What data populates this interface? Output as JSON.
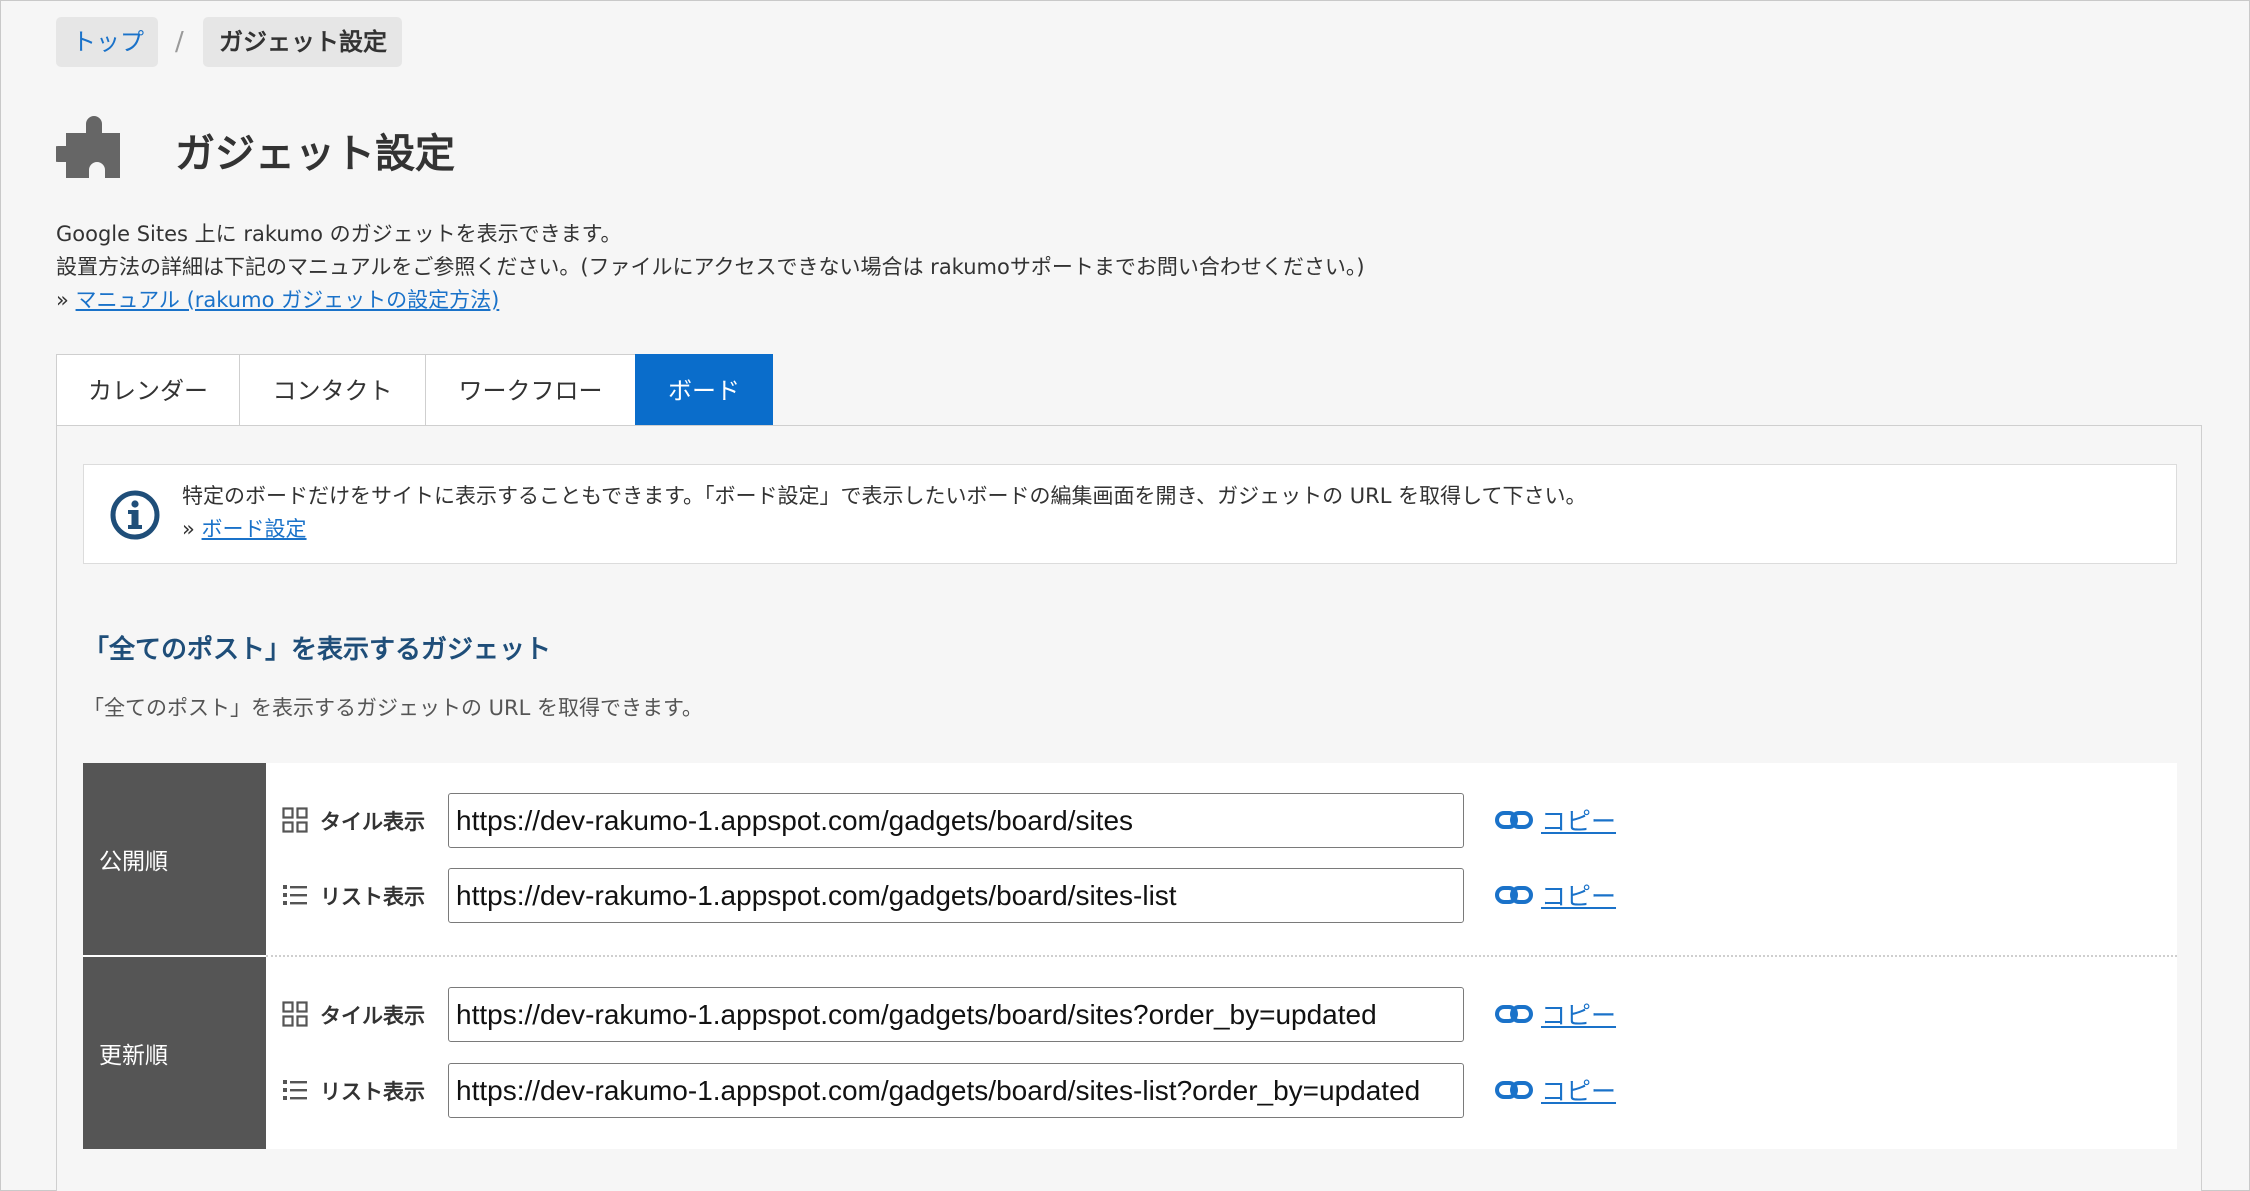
{
  "breadcrumb": {
    "top": "トップ",
    "separator": "/",
    "current": "ガジェット設定"
  },
  "page": {
    "title": "ガジェット設定"
  },
  "intro": {
    "line1": "Google Sites 上に rakumo のガジェットを表示できます。",
    "line2": "設置方法の詳細は下記のマニュアルをご参照ください。(ファイルにアクセスできない場合は rakumoサポートまでお問い合わせください。)",
    "prefix": "»",
    "manual_link": "マニュアル (rakumo ガジェットの設定方法)"
  },
  "tabs": [
    {
      "label": "カレンダー",
      "active": false
    },
    {
      "label": "コンタクト",
      "active": false
    },
    {
      "label": "ワークフロー",
      "active": false
    },
    {
      "label": "ボード",
      "active": true
    }
  ],
  "info": {
    "text": "特定のボードだけをサイトに表示することもできます。「ボード設定」で表示したいボードの編集画面を開き、ガジェットの URL を取得して下さい。",
    "prefix": "»",
    "link": "ボード設定"
  },
  "section": {
    "title": "「全てのポスト」を表示するガジェット",
    "description": "「全てのポスト」を表示するガジェットの URL を取得できます。"
  },
  "rows": [
    {
      "heading": "公開順",
      "lines": [
        {
          "mode": "タイル表示",
          "icon": "tile-icon",
          "url": "https://dev-rakumo-1.appspot.com/gadgets/board/sites",
          "copy": "コピー"
        },
        {
          "mode": "リスト表示",
          "icon": "list-icon",
          "url": "https://dev-rakumo-1.appspot.com/gadgets/board/sites-list",
          "copy": "コピー"
        }
      ]
    },
    {
      "heading": "更新順",
      "lines": [
        {
          "mode": "タイル表示",
          "icon": "tile-icon",
          "url": "https://dev-rakumo-1.appspot.com/gadgets/board/sites?order_by=updated",
          "copy": "コピー"
        },
        {
          "mode": "リスト表示",
          "icon": "list-icon",
          "url": "https://dev-rakumo-1.appspot.com/gadgets/board/sites-list?order_by=updated",
          "copy": "コピー"
        }
      ]
    }
  ],
  "colors": {
    "accent": "#0a6dcb",
    "link": "#1a72c9",
    "row_header": "#555555",
    "section_title": "#1f4e79"
  }
}
